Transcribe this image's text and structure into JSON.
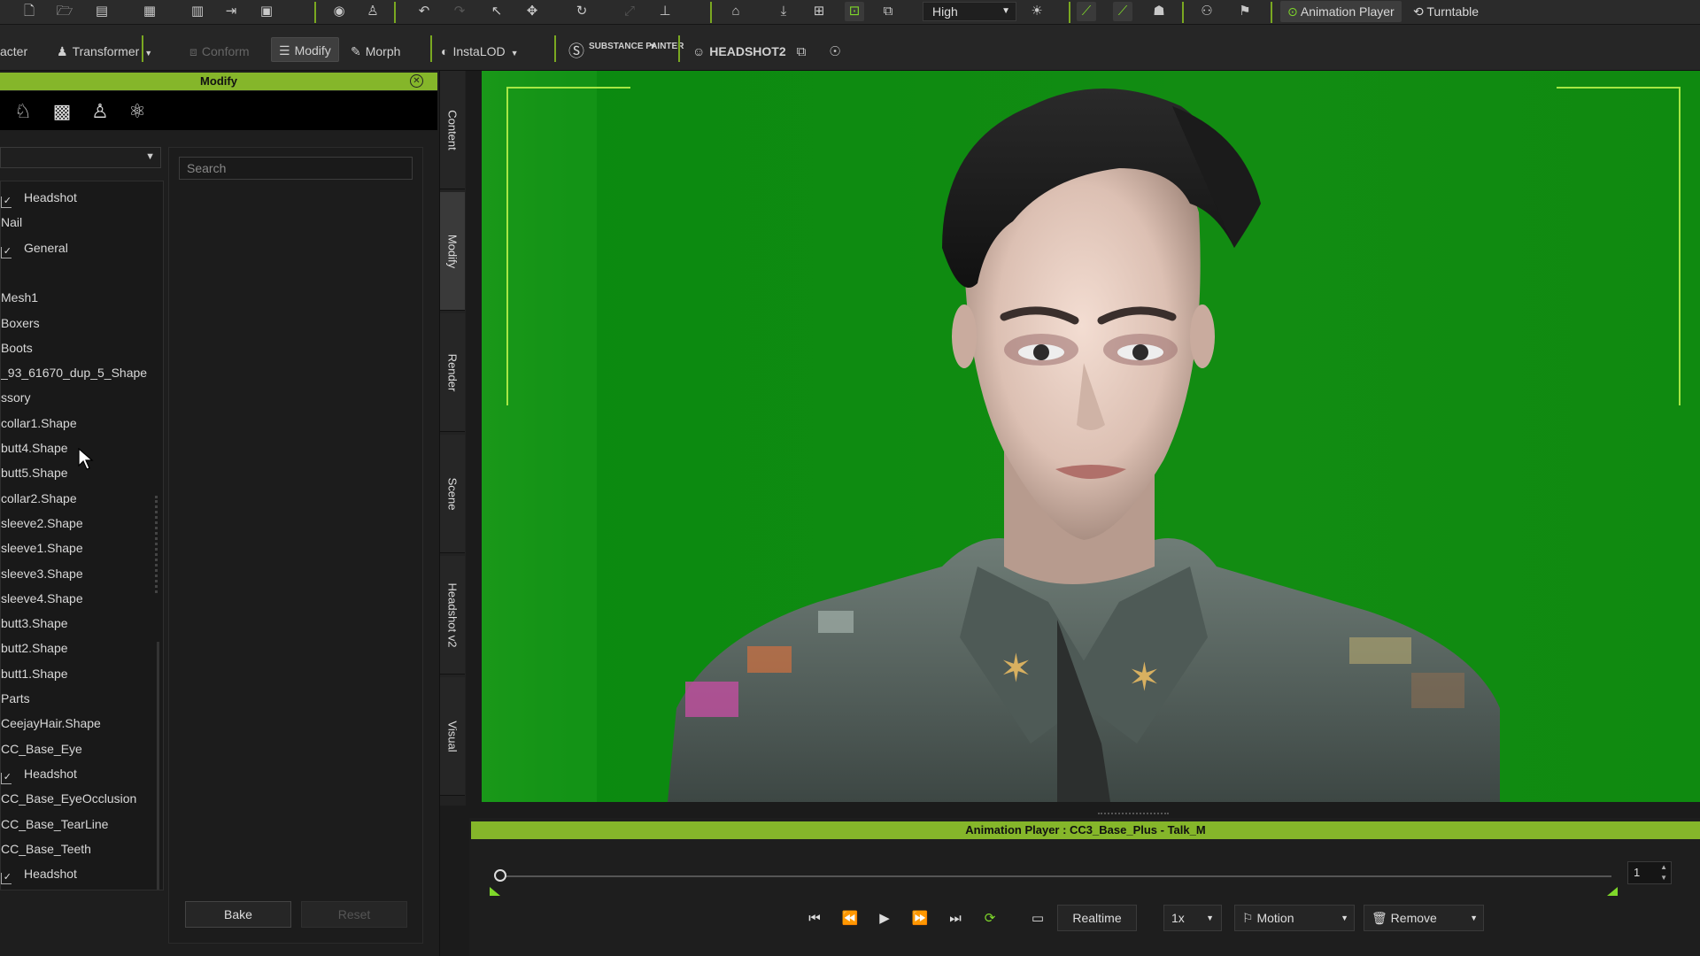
{
  "toolbar": {
    "quality_value": "High",
    "animation_player_label": "Animation Player",
    "turntable_label": "Turntable"
  },
  "toolbar2": {
    "character_label": "acter",
    "transformer_label": "Transformer",
    "conform_label": "Conform",
    "modify_label": "Modify",
    "morph_label": "Morph",
    "instalod_label": "InstaLOD",
    "substance_label": "SUBSTANCE PAINTER",
    "headshot2_label": "HEADSHOT2"
  },
  "modify_panel": {
    "title": "Modify",
    "search_placeholder": "Search",
    "bake_label": "Bake",
    "reset_label": "Reset",
    "tree_items": [
      {
        "label": "Headshot",
        "checked": true
      },
      {
        "label": "Nail",
        "checked": false
      },
      {
        "label": "General",
        "checked": true
      },
      {
        "label": "",
        "checked": false
      },
      {
        "label": "Mesh1",
        "checked": false
      },
      {
        "label": "Boxers",
        "checked": false
      },
      {
        "label": "Boots",
        "checked": false
      },
      {
        "label": "_93_61670_dup_5_Shape",
        "checked": false
      },
      {
        "label": "ssory",
        "checked": false
      },
      {
        "label": "collar1.Shape",
        "checked": false
      },
      {
        "label": "butt4.Shape",
        "checked": false
      },
      {
        "label": "butt5.Shape",
        "checked": false
      },
      {
        "label": "collar2.Shape",
        "checked": false
      },
      {
        "label": "sleeve2.Shape",
        "checked": false
      },
      {
        "label": "sleeve1.Shape",
        "checked": false
      },
      {
        "label": "sleeve3.Shape",
        "checked": false
      },
      {
        "label": "sleeve4.Shape",
        "checked": false
      },
      {
        "label": "butt3.Shape",
        "checked": false
      },
      {
        "label": "butt2.Shape",
        "checked": false
      },
      {
        "label": "butt1.Shape",
        "checked": false
      },
      {
        "label": " Parts",
        "checked": false
      },
      {
        "label": "CeejayHair.Shape",
        "checked": false
      },
      {
        "label": "CC_Base_Eye",
        "checked": false
      },
      {
        "label": "Headshot",
        "checked": true
      },
      {
        "label": "CC_Base_EyeOcclusion",
        "checked": false
      },
      {
        "label": "CC_Base_TearLine",
        "checked": false
      },
      {
        "label": "CC_Base_Teeth",
        "checked": false
      },
      {
        "label": "Headshot",
        "checked": true
      }
    ]
  },
  "vertical_tabs": [
    "Content",
    "Modify",
    "Render",
    "Scene",
    "Headshot v2",
    "Visual"
  ],
  "animation_player": {
    "title": "Animation Player : CC3_Base_Plus - Talk_M",
    "frame_value": "1",
    "realtime_label": "Realtime",
    "speed_value": "1x",
    "motion_label": "Motion",
    "remove_label": "Remove"
  }
}
